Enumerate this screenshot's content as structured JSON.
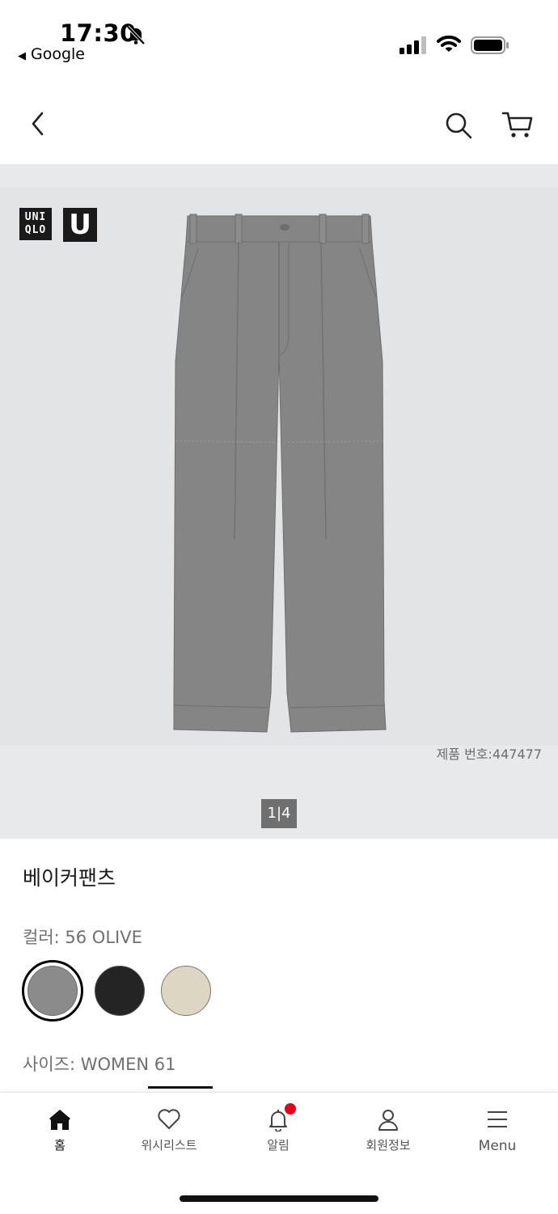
{
  "status_bar": {
    "time": "17:30",
    "back_app": "Google"
  },
  "header": {
    "icons": [
      "back-chevron-icon",
      "search-icon",
      "cart-icon"
    ]
  },
  "gallery": {
    "brand_logo_text": "UNI QLO",
    "brand_u_text": "U",
    "product_number": "제품 번호:447477",
    "pager_current": "1",
    "pager_total": "4",
    "image_color": "#808080"
  },
  "product": {
    "name": "베이커팬츠",
    "color_label": "컬러: 56 OLIVE",
    "size_label": "사이즈: WOMEN 61",
    "swatches": [
      {
        "name": "gray",
        "color": "#8b8b8b",
        "selected": true
      },
      {
        "name": "black",
        "color": "#242424",
        "selected": false
      },
      {
        "name": "beige",
        "color": "#ddd6c3",
        "selected": false
      }
    ]
  },
  "bottom_nav": {
    "items": [
      {
        "label": "홈",
        "icon": "home-icon",
        "active": true
      },
      {
        "label": "위시리스트",
        "icon": "heart-icon",
        "active": false
      },
      {
        "label": "알림",
        "icon": "bell-icon",
        "active": false,
        "badge": true
      },
      {
        "label": "회원정보",
        "icon": "user-icon",
        "active": false
      },
      {
        "label": "Menu",
        "icon": "menu-icon",
        "active": false
      }
    ]
  },
  "colors": {
    "accent_badge": "#e4001b",
    "logo_bg": "#1a1a1a"
  }
}
